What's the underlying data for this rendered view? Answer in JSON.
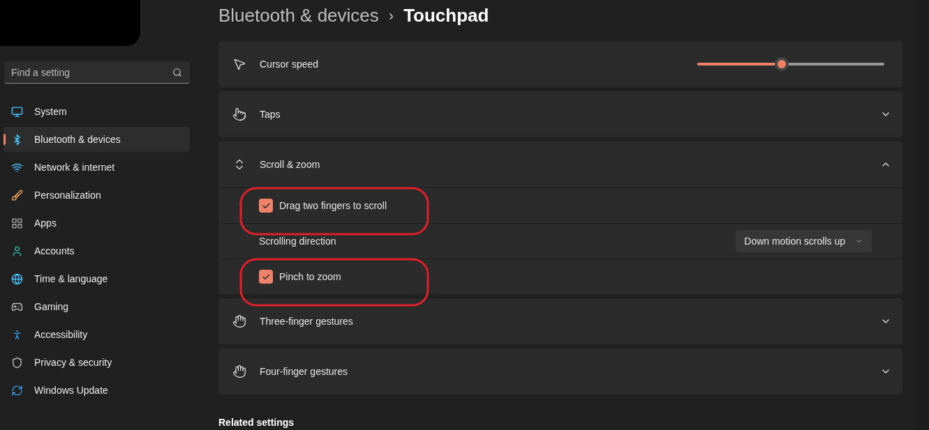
{
  "breadcrumb": {
    "parent": "Bluetooth & devices",
    "separator": "›",
    "current": "Touchpad"
  },
  "search": {
    "placeholder": "Find a setting"
  },
  "sidebar": {
    "items": [
      {
        "label": "System",
        "selected": false
      },
      {
        "label": "Bluetooth & devices",
        "selected": true
      },
      {
        "label": "Network & internet",
        "selected": false
      },
      {
        "label": "Personalization",
        "selected": false
      },
      {
        "label": "Apps",
        "selected": false
      },
      {
        "label": "Accounts",
        "selected": false
      },
      {
        "label": "Time & language",
        "selected": false
      },
      {
        "label": "Gaming",
        "selected": false
      },
      {
        "label": "Accessibility",
        "selected": false
      },
      {
        "label": "Privacy & security",
        "selected": false
      },
      {
        "label": "Windows Update",
        "selected": false
      }
    ]
  },
  "cards": [
    {
      "kind": "slider",
      "label": "Cursor speed",
      "level": 0.45
    },
    {
      "kind": "expander",
      "label": "Taps",
      "expanded": false
    },
    {
      "kind": "expander",
      "label": "Scroll & zoom",
      "expanded": true,
      "rows": [
        {
          "kind": "checkbox",
          "label": "Drag two fingers to scroll",
          "checked": true,
          "circled": true
        },
        {
          "kind": "dropdown",
          "label": "Scrolling direction",
          "value": "Down motion scrolls up"
        },
        {
          "kind": "checkbox",
          "label": "Pinch to zoom",
          "checked": true,
          "circled": true
        }
      ]
    },
    {
      "kind": "expander",
      "label": "Three-finger gestures",
      "expanded": false
    },
    {
      "kind": "expander",
      "label": "Four-finger gestures",
      "expanded": false
    }
  ],
  "related_settings": {
    "title": "Related settings"
  }
}
